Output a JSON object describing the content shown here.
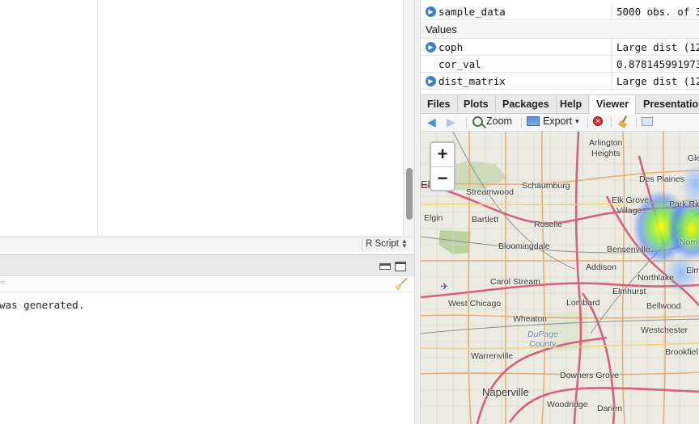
{
  "editor": {
    "language_mode": "R Script"
  },
  "console": {
    "output_line": "was generated."
  },
  "environment": {
    "rows_top": [
      {
        "name": "sample_data",
        "value": "5000 obs. of 3",
        "expandable": true
      }
    ],
    "section_label": "Values",
    "rows_values": [
      {
        "name": "coph",
        "value": "Large dist (12",
        "expandable": true
      },
      {
        "name": "cor_val",
        "value": "0.8781459919733",
        "expandable": false
      },
      {
        "name": "dist_matrix",
        "value": "Large dist (12",
        "expandable": true
      }
    ]
  },
  "tabs": [
    {
      "label": "Files",
      "active": false
    },
    {
      "label": "Plots",
      "active": false
    },
    {
      "label": "Packages",
      "active": false
    },
    {
      "label": "Help",
      "active": false
    },
    {
      "label": "Viewer",
      "active": true
    },
    {
      "label": "Presentation",
      "active": false
    }
  ],
  "viewer_toolbar": {
    "zoom_label": "Zoom",
    "export_label": "Export",
    "export_caret": "▾"
  },
  "map": {
    "zoom_in": "+",
    "zoom_out": "−",
    "labels": [
      {
        "text": "Arlington",
        "key": "arlington"
      },
      {
        "text": "Heights",
        "key": "heights"
      },
      {
        "text": "Gle",
        "key": "gle"
      },
      {
        "text": "Des Plaines",
        "key": "desplaines"
      },
      {
        "text": "Schaumburg",
        "key": "schaumburg"
      },
      {
        "text": "Elg",
        "key": "elg"
      },
      {
        "text": "Streamwood",
        "key": "streamwood"
      },
      {
        "text": "Elk Grove",
        "key": "elkgrove"
      },
      {
        "text": "Village",
        "key": "village"
      },
      {
        "text": "Park Rid",
        "key": "parkrid"
      },
      {
        "text": "Elgin",
        "key": "elgin"
      },
      {
        "text": "Bartlett",
        "key": "bartlett"
      },
      {
        "text": "Roselle",
        "key": "roselle"
      },
      {
        "text": "Bloomingdale",
        "key": "bloomingdale"
      },
      {
        "text": "Bensenville",
        "key": "bensenville"
      },
      {
        "text": "Norri",
        "key": "norri"
      },
      {
        "text": "Addison",
        "key": "addison"
      },
      {
        "text": "Elm",
        "key": "elm"
      },
      {
        "text": "Carol Stream",
        "key": "carolstream"
      },
      {
        "text": "Northlake",
        "key": "northlake"
      },
      {
        "text": "Elmhurst",
        "key": "elmhurst"
      },
      {
        "text": "West Chicago",
        "key": "westchicago"
      },
      {
        "text": "Lombard",
        "key": "lombard"
      },
      {
        "text": "Bellwood",
        "key": "bellwood"
      },
      {
        "text": "Wheaton",
        "key": "wheaton"
      },
      {
        "text": "Westchester",
        "key": "westchester"
      },
      {
        "text": "DuPage",
        "key": "dupage"
      },
      {
        "text": "County",
        "key": "county"
      },
      {
        "text": "Brookfiel",
        "key": "brookfiel"
      },
      {
        "text": "Warrenville",
        "key": "warrenville"
      },
      {
        "text": "Downers Grove",
        "key": "downersgrove"
      },
      {
        "text": "Naperville",
        "key": "naperville"
      },
      {
        "text": "Woodridge",
        "key": "woodridge"
      },
      {
        "text": "Darien",
        "key": "darien"
      }
    ]
  }
}
